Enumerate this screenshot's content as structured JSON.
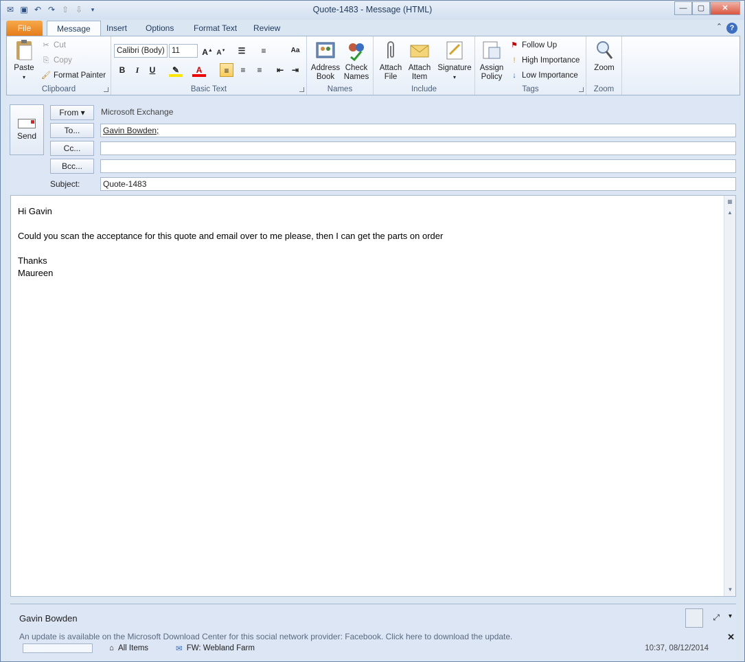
{
  "window": {
    "title": "Quote-1483 - Message (HTML)"
  },
  "quick_access": {
    "icons": [
      "outlook-icon",
      "save-icon",
      "undo-icon",
      "redo-icon",
      "up-icon",
      "down-icon",
      "customize-icon"
    ]
  },
  "tabs": [
    {
      "label": "File"
    },
    {
      "label": "Message"
    },
    {
      "label": "Insert"
    },
    {
      "label": "Options"
    },
    {
      "label": "Format Text"
    },
    {
      "label": "Review"
    }
  ],
  "ribbon": {
    "clipboard": {
      "label": "Clipboard",
      "paste": "Paste",
      "cut": "Cut",
      "copy": "Copy",
      "format_painter": "Format Painter"
    },
    "basic_text": {
      "label": "Basic Text",
      "font": "Calibri (Body)",
      "size": "11",
      "bold": "B",
      "italic": "I",
      "underline": "U"
    },
    "names": {
      "label": "Names",
      "address_book_1": "Address",
      "address_book_2": "Book",
      "check_names_1": "Check",
      "check_names_2": "Names"
    },
    "include": {
      "label": "Include",
      "attach_file_1": "Attach",
      "attach_file_2": "File",
      "attach_item_1": "Attach",
      "attach_item_2": "Item",
      "signature": "Signature"
    },
    "tags": {
      "label": "Tags",
      "assign_1": "Assign",
      "assign_2": "Policy",
      "follow_up": "Follow Up",
      "high": "High Importance",
      "low": "Low Importance"
    },
    "zoom": {
      "label": "Zoom",
      "zoom": "Zoom"
    }
  },
  "header": {
    "send": "Send",
    "from_btn": "From",
    "from_value": "Microsoft Exchange",
    "to_btn": "To...",
    "to_value": "Gavin Bowden;",
    "cc_btn": "Cc...",
    "bcc_btn": "Bcc...",
    "subject_label": "Subject:",
    "subject_value": "Quote-1483"
  },
  "body": {
    "line1": "Hi Gavin",
    "line2": "Could you scan the acceptance for this quote and email over to me please, then I can get the parts on order",
    "line3": "Thanks",
    "line4": "Maureen"
  },
  "people_pane": {
    "name": "Gavin Bowden",
    "info": "An update is available on the Microsoft Download Center for this social network provider: Facebook. Click here to download the update.",
    "item_scope": "All Items",
    "item_subject": "FW: Webland Farm",
    "item_time": "10:37, 08/12/2014"
  },
  "colors": {
    "accent": "#e57a17",
    "ribbon": "#dbe6f3"
  }
}
